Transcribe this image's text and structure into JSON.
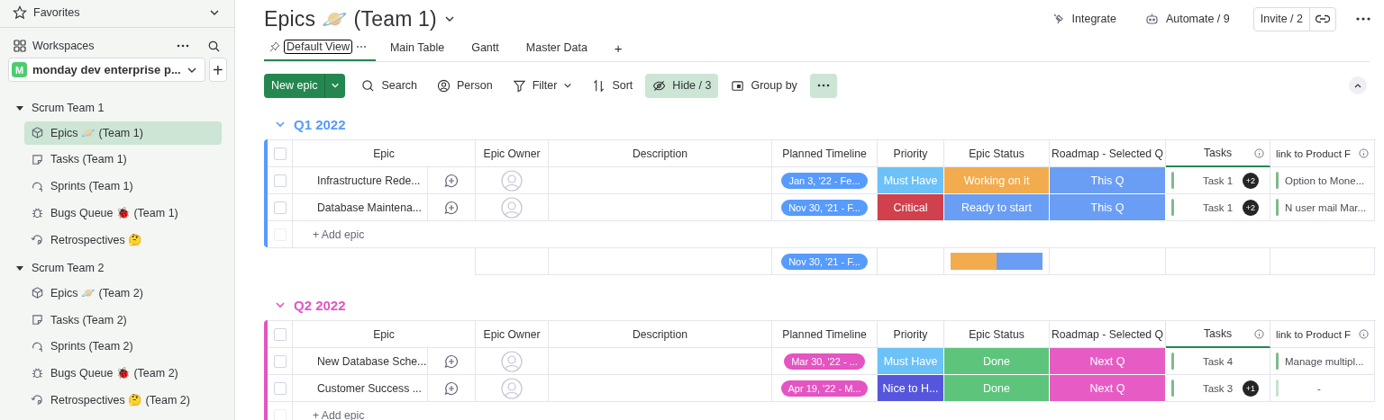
{
  "sidebar": {
    "favorites": "Favorites",
    "workspaces": "Workspaces",
    "workspace": {
      "badge": "M",
      "name": "monday dev enterprise p..."
    },
    "add": "+",
    "folders": [
      {
        "label": "Scrum Team 1",
        "expanded": true,
        "children": [
          {
            "label": "Epics 🪐 (Team 1)",
            "kind": "epic",
            "selected": true
          },
          {
            "label": "Tasks (Team 1)",
            "kind": "doc",
            "selected": false
          },
          {
            "label": "Sprints (Team 1)",
            "kind": "sprint",
            "selected": false
          },
          {
            "label": "Bugs Queue 🐞 (Team 1)",
            "kind": "bug",
            "selected": false
          },
          {
            "label": "Retrospectives 🤔",
            "kind": "retro",
            "selected": false
          }
        ]
      },
      {
        "label": "Scrum Team 2",
        "expanded": true,
        "children": [
          {
            "label": "Epics 🪐 (Team 2)",
            "kind": "epic",
            "selected": false
          },
          {
            "label": "Tasks (Team 2)",
            "kind": "doc",
            "selected": false
          },
          {
            "label": "Sprints (Team 2)",
            "kind": "sprint",
            "selected": false
          },
          {
            "label": "Bugs Queue 🐞 (Team 2)",
            "kind": "bug",
            "selected": false
          },
          {
            "label": "Retrospectives 🤔 (Team 2)",
            "kind": "retro",
            "selected": false
          }
        ]
      }
    ]
  },
  "board": {
    "title": "Epics 🪐 (Team 1)",
    "actions": [
      {
        "label": "Integrate",
        "kind": "integrate"
      },
      {
        "label": "Automate / 9",
        "kind": "automate"
      }
    ],
    "invite": "Invite / 2",
    "tabs": [
      {
        "label": "Default View",
        "selected": true,
        "pinned": true
      },
      {
        "label": "Main Table",
        "selected": false,
        "pinned": false
      },
      {
        "label": "Gantt",
        "selected": false,
        "pinned": false
      },
      {
        "label": "Master Data",
        "selected": false,
        "pinned": false
      }
    ],
    "add_tab": "+",
    "new_button": "New epic",
    "toolbar": [
      {
        "label": "Search",
        "kind": "search",
        "active": false
      },
      {
        "label": "Person",
        "kind": "person",
        "active": false
      },
      {
        "label": "Filter",
        "kind": "filter",
        "active": false
      },
      {
        "label": "Sort",
        "kind": "sort",
        "active": false
      },
      {
        "label": "Hide / 3",
        "kind": "hide",
        "active": true
      },
      {
        "label": "Group by",
        "kind": "group",
        "active": false
      }
    ]
  },
  "groups": [
    {
      "title": "Q1 2022",
      "color": "#579bfc",
      "columns": [
        "Epic",
        "Epic Owner",
        "Description",
        "Planned Timeline",
        "Priority",
        "Epic Status",
        "Roadmap - Selected Q",
        "Tasks",
        "link to Product F"
      ],
      "rows": [
        {
          "name": "Infrastructure Rede...",
          "timeline": "Jan 3, '22 - Fe...",
          "priority": {
            "label": "Must Have",
            "color": "#6cc1f7"
          },
          "status": {
            "label": "Working on it",
            "color": "#f2ac4e"
          },
          "roadmap": {
            "label": "This Q",
            "color": "#6a9ef4"
          },
          "task": "Task 1",
          "task_more": "+2",
          "link": "Option to Mone...",
          "linked": true,
          "checked": false
        },
        {
          "name": "Database Maintena...",
          "timeline": "Nov 30, '21 - F...",
          "priority": {
            "label": "Critical",
            "color": "#d0404d"
          },
          "status": {
            "label": "Ready to start",
            "color": "#6a9ef4"
          },
          "roadmap": {
            "label": "This Q",
            "color": "#6a9ef4"
          },
          "task": "Task 1",
          "task_more": "+2",
          "link": "N user mail Mar...",
          "linked": true,
          "checked": false
        }
      ],
      "all_checked": false,
      "add_label": "+ Add epic",
      "summary": {
        "timeline": "Nov 30, '21 - F..."
      }
    },
    {
      "title": "Q2 2022",
      "color": "#e454c2",
      "columns": [
        "Epic",
        "Epic Owner",
        "Description",
        "Planned Timeline",
        "Priority",
        "Epic Status",
        "Roadmap - Selected Q",
        "Tasks",
        "link to Product F"
      ],
      "rows": [
        {
          "name": "New Database Sche...",
          "timeline": "Mar 30, '22 - ...",
          "priority": {
            "label": "Must Have",
            "color": "#6cc1f7"
          },
          "status": {
            "label": "Done",
            "color": "#5dc47c"
          },
          "roadmap": {
            "label": "Next Q",
            "color": "#e75cc4"
          },
          "task": "Task 4",
          "link": "Manage multipl...",
          "linked": true,
          "checked": false
        },
        {
          "name": "Customer Success ...",
          "timeline": "Apr 19, '22 - M...",
          "priority": {
            "label": "Nice to H...",
            "color": "#5656dc"
          },
          "status": {
            "label": "Done",
            "color": "#5dc47c"
          },
          "roadmap": {
            "label": "Next Q",
            "color": "#e75cc4"
          },
          "task": "Task 3",
          "task_more": "+1",
          "link": "-",
          "linked": false,
          "checked": false
        }
      ],
      "all_checked": false,
      "add_label": "+ Add epic"
    }
  ]
}
